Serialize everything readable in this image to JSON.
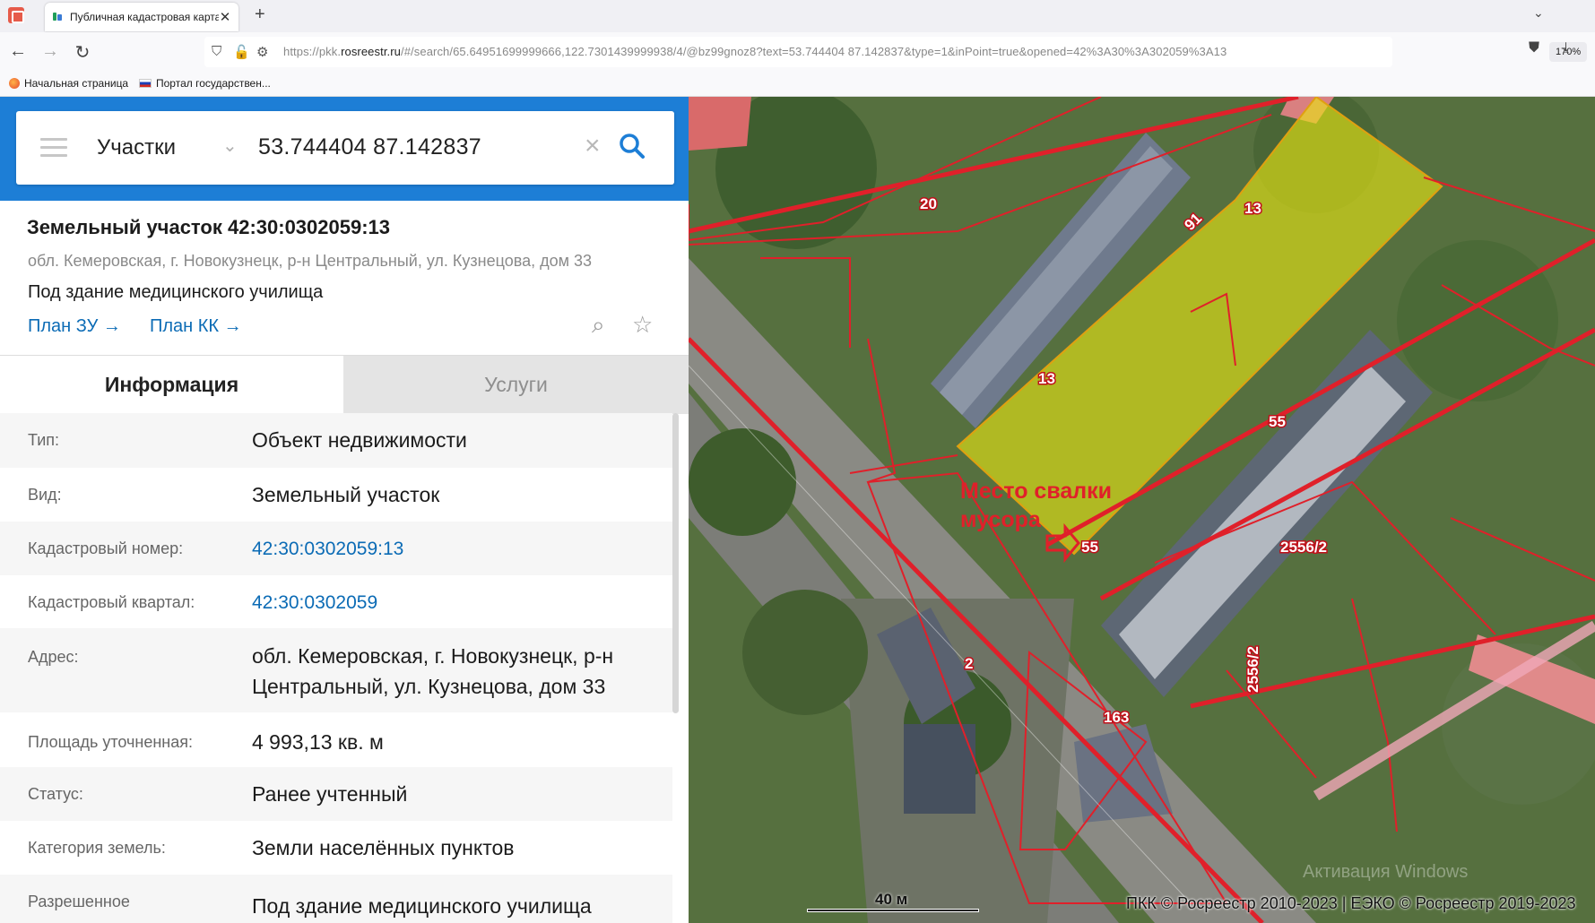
{
  "browser": {
    "tab_title": "Публичная кадастровая карта",
    "url_prefix": "https://pkk.",
    "url_host": "rosreestr.ru",
    "url_rest": "/#/search/65.64951699999666,122.7301439999938/4/@bz99gnoz8?text=53.744404 87.142837&type=1&inPoint=true&opened=42%3A30%3A302059%3A13",
    "zoom": "170%",
    "bookmarks": [
      "Начальная страница",
      "Портал государствен..."
    ]
  },
  "search": {
    "mode": "Участки",
    "query": "53.744404 87.142837"
  },
  "object": {
    "title": "Земельный участок 42:30:0302059:13",
    "address": "обл. Кемеровская, г. Новокузнецк, р-н Центральный, ул. Кузнецова, дом 33",
    "use": "Под здание медицинского училища",
    "plan_zu": "План ЗУ",
    "plan_kk": "План КК"
  },
  "tabs": {
    "info": "Информация",
    "services": "Услуги"
  },
  "rows": [
    {
      "label": "Тип:",
      "value": "Объект недвижимости"
    },
    {
      "label": "Вид:",
      "value": "Земельный участок"
    },
    {
      "label": "Кадастровый номер:",
      "value": "42:30:0302059:13"
    },
    {
      "label": "Кадастровый квартал:",
      "value": "42:30:0302059"
    },
    {
      "label": "Адрес:",
      "value": "обл. Кемеровская, г. Новокузнецк, р-н Центральный, ул. Кузнецова, дом 33"
    },
    {
      "label": "Площадь уточненная:",
      "value": "4 993,13 кв. м"
    },
    {
      "label": "Статус:",
      "value": "Ранее учтенный"
    },
    {
      "label": "Категория земель:",
      "value": "Земли населённых пунктов"
    },
    {
      "label": "Разрешенное",
      "value": "Под здание медицинского училища"
    }
  ],
  "map": {
    "parcel_labels": [
      "20",
      "91",
      "13",
      "13",
      "55",
      "55",
      "2556/2",
      "2556/2",
      "2",
      "163"
    ],
    "annotation": [
      "Место свалки",
      "мусора"
    ],
    "scale": "40 м",
    "copyright": "ПКК © Росреестр 2010-2023 | ЕЭКО © Росреестр 2019-2023",
    "watermark": "Активация Windows",
    "highlight_color": "#e8e612",
    "boundary_color": "#e0202a"
  }
}
